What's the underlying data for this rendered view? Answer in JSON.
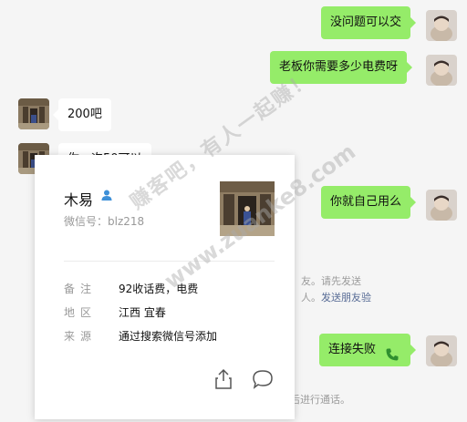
{
  "chat": {
    "messages": [
      {
        "side": "me",
        "text": "没问题可以交"
      },
      {
        "side": "me",
        "text": "老板你需要多少电费呀"
      },
      {
        "side": "them",
        "text": "200吧"
      },
      {
        "side": "them",
        "text": "你一次50可以"
      },
      {
        "side": "me",
        "text": "你就自己用么"
      },
      {
        "side": "me",
        "text": "连接失败"
      }
    ],
    "system_notice_1": "友。请先发送",
    "system_notice_2a": "人。",
    "system_notice_2b": "发送朋友验",
    "system_notice_3": "后进行通话。"
  },
  "profile_card": {
    "name": "木易",
    "wechat_id_label": "微信号：",
    "wechat_id": "blz218",
    "remark_label": "备注",
    "remark": "92收话费，电费",
    "region_label": "地区",
    "region": "江西 宜春",
    "source_label": "来源",
    "source": "通过搜索微信号添加"
  },
  "watermark": {
    "line1": "赚客吧，有人一起赚！",
    "line2": "www.zuanke8.com"
  },
  "icons": [
    "user-icon",
    "share-icon",
    "chat-icon",
    "phone-icon"
  ],
  "colors": {
    "my_bubble": "#95ec69",
    "their_bubble": "#ffffff",
    "link": "#576b95",
    "background": "#f5f5f5"
  }
}
